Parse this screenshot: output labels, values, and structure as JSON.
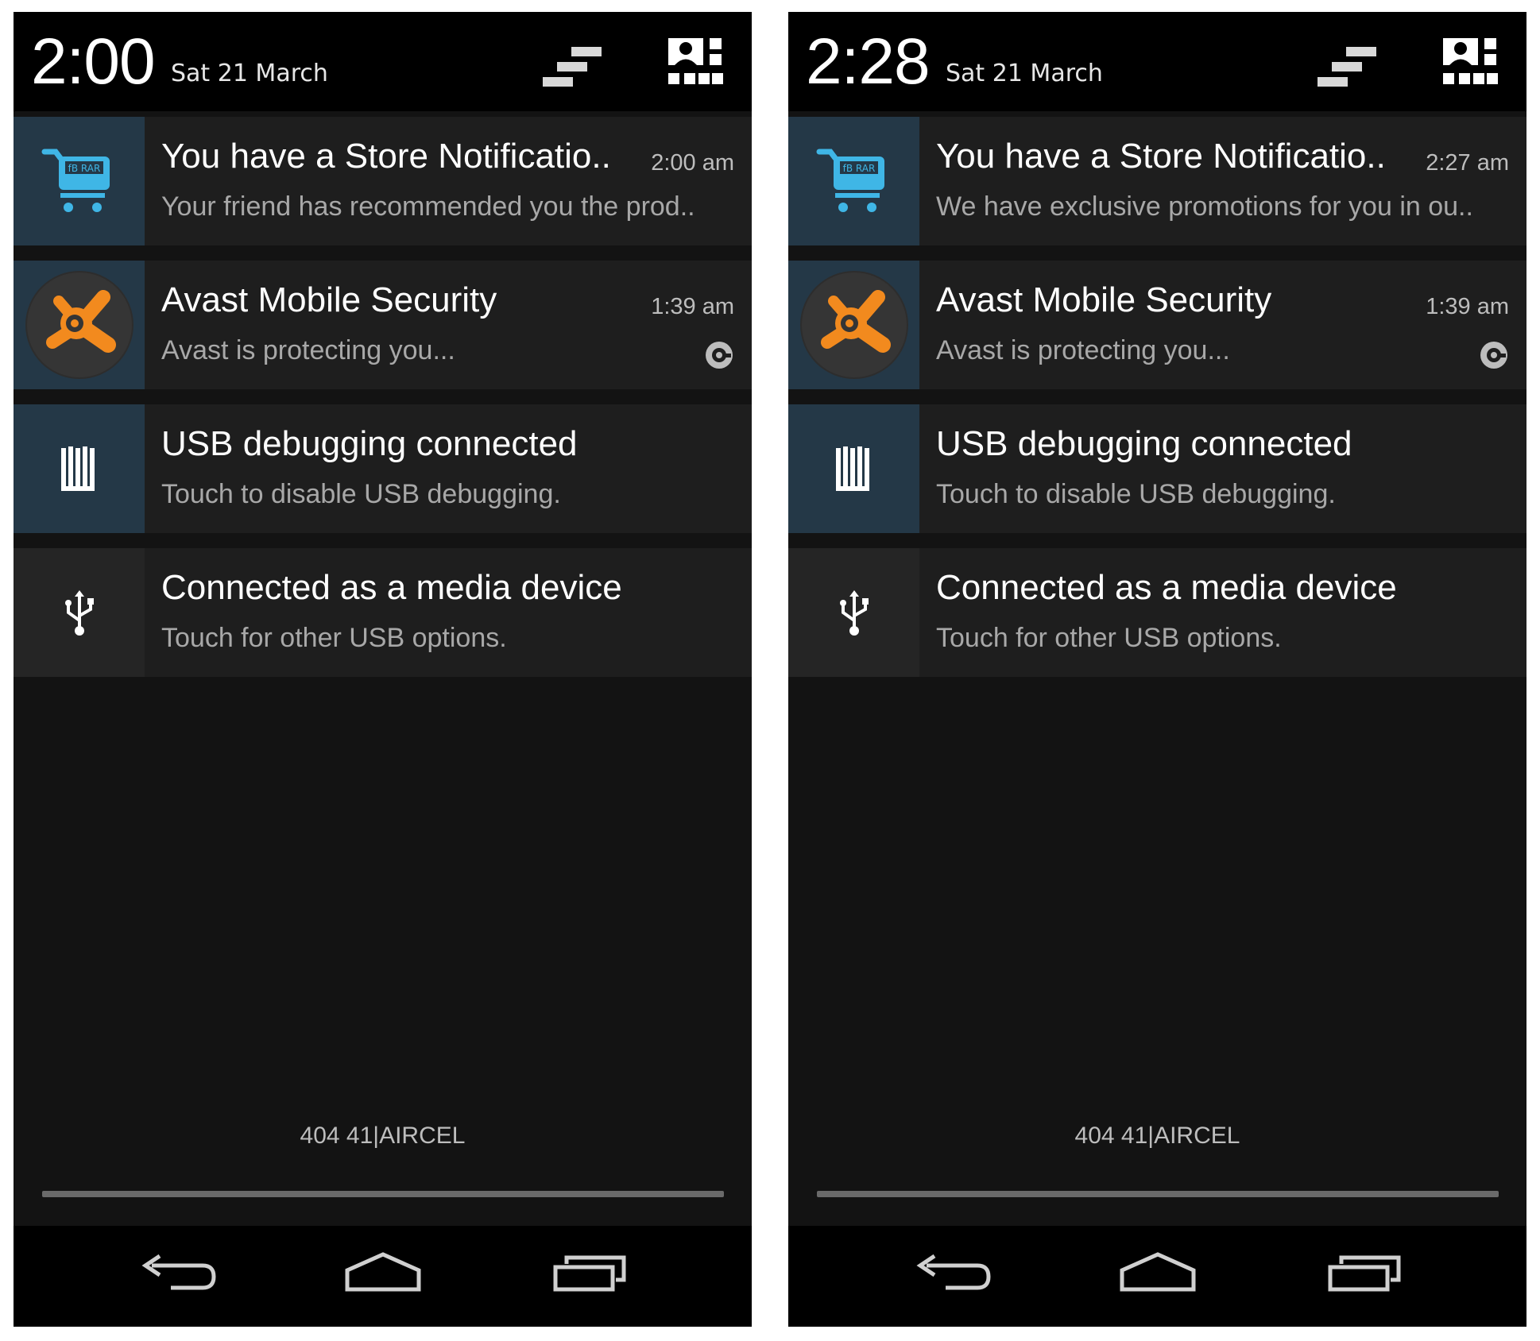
{
  "screens": [
    {
      "header": {
        "clock": "2:00",
        "date": "Sat 21 March"
      },
      "notifications": [
        {
          "title": "You have a Store Notificatio..",
          "text": "Your friend has recommended you the prod..",
          "time": "2:00 am",
          "icon": "store-cart-icon"
        },
        {
          "title": "Avast Mobile Security",
          "text": "Avast is protecting you...",
          "time": "1:39 am",
          "icon": "avast-icon"
        },
        {
          "title": "USB debugging connected",
          "text": "Touch to disable USB debugging.",
          "icon": "usb-debugging-icon"
        },
        {
          "title": "Connected as a media device",
          "text": "Touch for other USB options.",
          "icon": "usb-icon"
        }
      ],
      "carrier": "404 41|AIRCEL"
    },
    {
      "header": {
        "clock": "2:28",
        "date": "Sat 21 March"
      },
      "notifications": [
        {
          "title": "You have a Store Notificatio..",
          "text": "We have exclusive promotions for you in ou..",
          "time": "2:27 am",
          "icon": "store-cart-icon"
        },
        {
          "title": "Avast Mobile Security",
          "text": "Avast is protecting you...",
          "time": "1:39 am",
          "icon": "avast-icon"
        },
        {
          "title": "USB debugging connected",
          "text": "Touch to disable USB debugging.",
          "icon": "usb-debugging-icon"
        },
        {
          "title": "Connected as a media device",
          "text": "Touch for other USB options.",
          "icon": "usb-icon"
        }
      ],
      "carrier": "404 41|AIRCEL"
    }
  ],
  "colors": {
    "header_bg": "#000000",
    "panel_bg": "#131313",
    "card_bg": "#1e1e1e",
    "icon_teal": "#243847",
    "cart_blue": "#3fb6e6",
    "avast_orange": "#f28a1e"
  }
}
